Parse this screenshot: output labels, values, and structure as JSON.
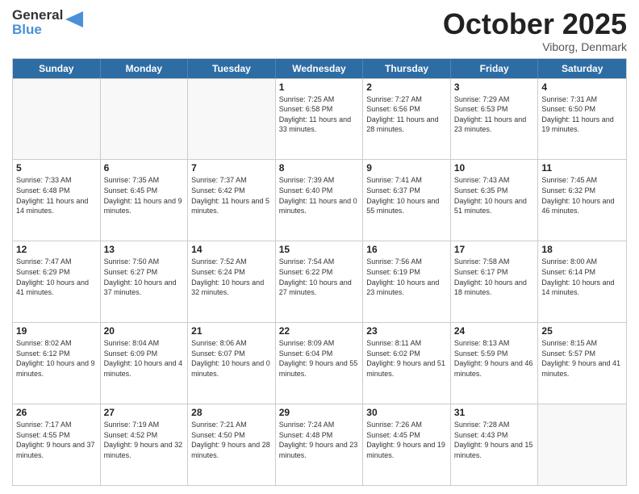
{
  "header": {
    "logo_general": "General",
    "logo_blue": "Blue",
    "month_title": "October 2025",
    "location": "Viborg, Denmark"
  },
  "days_of_week": [
    "Sunday",
    "Monday",
    "Tuesday",
    "Wednesday",
    "Thursday",
    "Friday",
    "Saturday"
  ],
  "weeks": [
    [
      {
        "day": "",
        "empty": true
      },
      {
        "day": "",
        "empty": true
      },
      {
        "day": "",
        "empty": true
      },
      {
        "day": "1",
        "sunrise": "7:25 AM",
        "sunset": "6:58 PM",
        "daylight": "11 hours and 33 minutes."
      },
      {
        "day": "2",
        "sunrise": "7:27 AM",
        "sunset": "6:56 PM",
        "daylight": "11 hours and 28 minutes."
      },
      {
        "day": "3",
        "sunrise": "7:29 AM",
        "sunset": "6:53 PM",
        "daylight": "11 hours and 23 minutes."
      },
      {
        "day": "4",
        "sunrise": "7:31 AM",
        "sunset": "6:50 PM",
        "daylight": "11 hours and 19 minutes."
      }
    ],
    [
      {
        "day": "5",
        "sunrise": "7:33 AM",
        "sunset": "6:48 PM",
        "daylight": "11 hours and 14 minutes."
      },
      {
        "day": "6",
        "sunrise": "7:35 AM",
        "sunset": "6:45 PM",
        "daylight": "11 hours and 9 minutes."
      },
      {
        "day": "7",
        "sunrise": "7:37 AM",
        "sunset": "6:42 PM",
        "daylight": "11 hours and 5 minutes."
      },
      {
        "day": "8",
        "sunrise": "7:39 AM",
        "sunset": "6:40 PM",
        "daylight": "11 hours and 0 minutes."
      },
      {
        "day": "9",
        "sunrise": "7:41 AM",
        "sunset": "6:37 PM",
        "daylight": "10 hours and 55 minutes."
      },
      {
        "day": "10",
        "sunrise": "7:43 AM",
        "sunset": "6:35 PM",
        "daylight": "10 hours and 51 minutes."
      },
      {
        "day": "11",
        "sunrise": "7:45 AM",
        "sunset": "6:32 PM",
        "daylight": "10 hours and 46 minutes."
      }
    ],
    [
      {
        "day": "12",
        "sunrise": "7:47 AM",
        "sunset": "6:29 PM",
        "daylight": "10 hours and 41 minutes."
      },
      {
        "day": "13",
        "sunrise": "7:50 AM",
        "sunset": "6:27 PM",
        "daylight": "10 hours and 37 minutes."
      },
      {
        "day": "14",
        "sunrise": "7:52 AM",
        "sunset": "6:24 PM",
        "daylight": "10 hours and 32 minutes."
      },
      {
        "day": "15",
        "sunrise": "7:54 AM",
        "sunset": "6:22 PM",
        "daylight": "10 hours and 27 minutes."
      },
      {
        "day": "16",
        "sunrise": "7:56 AM",
        "sunset": "6:19 PM",
        "daylight": "10 hours and 23 minutes."
      },
      {
        "day": "17",
        "sunrise": "7:58 AM",
        "sunset": "6:17 PM",
        "daylight": "10 hours and 18 minutes."
      },
      {
        "day": "18",
        "sunrise": "8:00 AM",
        "sunset": "6:14 PM",
        "daylight": "10 hours and 14 minutes."
      }
    ],
    [
      {
        "day": "19",
        "sunrise": "8:02 AM",
        "sunset": "6:12 PM",
        "daylight": "10 hours and 9 minutes."
      },
      {
        "day": "20",
        "sunrise": "8:04 AM",
        "sunset": "6:09 PM",
        "daylight": "10 hours and 4 minutes."
      },
      {
        "day": "21",
        "sunrise": "8:06 AM",
        "sunset": "6:07 PM",
        "daylight": "10 hours and 0 minutes."
      },
      {
        "day": "22",
        "sunrise": "8:09 AM",
        "sunset": "6:04 PM",
        "daylight": "9 hours and 55 minutes."
      },
      {
        "day": "23",
        "sunrise": "8:11 AM",
        "sunset": "6:02 PM",
        "daylight": "9 hours and 51 minutes."
      },
      {
        "day": "24",
        "sunrise": "8:13 AM",
        "sunset": "5:59 PM",
        "daylight": "9 hours and 46 minutes."
      },
      {
        "day": "25",
        "sunrise": "8:15 AM",
        "sunset": "5:57 PM",
        "daylight": "9 hours and 41 minutes."
      }
    ],
    [
      {
        "day": "26",
        "sunrise": "7:17 AM",
        "sunset": "4:55 PM",
        "daylight": "9 hours and 37 minutes."
      },
      {
        "day": "27",
        "sunrise": "7:19 AM",
        "sunset": "4:52 PM",
        "daylight": "9 hours and 32 minutes."
      },
      {
        "day": "28",
        "sunrise": "7:21 AM",
        "sunset": "4:50 PM",
        "daylight": "9 hours and 28 minutes."
      },
      {
        "day": "29",
        "sunrise": "7:24 AM",
        "sunset": "4:48 PM",
        "daylight": "9 hours and 23 minutes."
      },
      {
        "day": "30",
        "sunrise": "7:26 AM",
        "sunset": "4:45 PM",
        "daylight": "9 hours and 19 minutes."
      },
      {
        "day": "31",
        "sunrise": "7:28 AM",
        "sunset": "4:43 PM",
        "daylight": "9 hours and 15 minutes."
      },
      {
        "day": "",
        "empty": true
      }
    ]
  ]
}
